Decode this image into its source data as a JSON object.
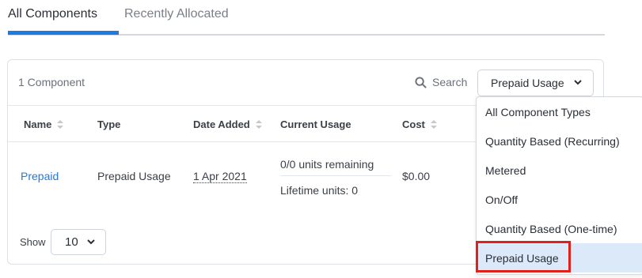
{
  "tabs": [
    {
      "label": "All Components",
      "active": true
    },
    {
      "label": "Recently Allocated",
      "active": false
    }
  ],
  "toolbar": {
    "count_text": "1 Component",
    "search_label": "Search",
    "filter_value": "Prepaid Usage"
  },
  "table": {
    "columns": [
      "Name",
      "Type",
      "Date Added",
      "Current Usage",
      "Cost"
    ],
    "rows": [
      {
        "name": "Prepaid",
        "type": "Prepaid Usage",
        "date_added": "1 Apr 2021",
        "usage_remaining": "0/0 units remaining",
        "lifetime_units": "Lifetime units: 0",
        "cost": "$0.00"
      }
    ]
  },
  "pagination": {
    "show_label": "Show",
    "page_size": "10"
  },
  "dropdown": {
    "options": [
      "All Component Types",
      "Quantity Based (Recurring)",
      "Metered",
      "On/Off",
      "Quantity Based (One-time)",
      "Prepaid Usage"
    ],
    "selected": "Prepaid Usage"
  },
  "colors": {
    "accent": "#1f7ae0",
    "selected_bg": "#dbe9f9",
    "highlight": "#e0201b"
  }
}
